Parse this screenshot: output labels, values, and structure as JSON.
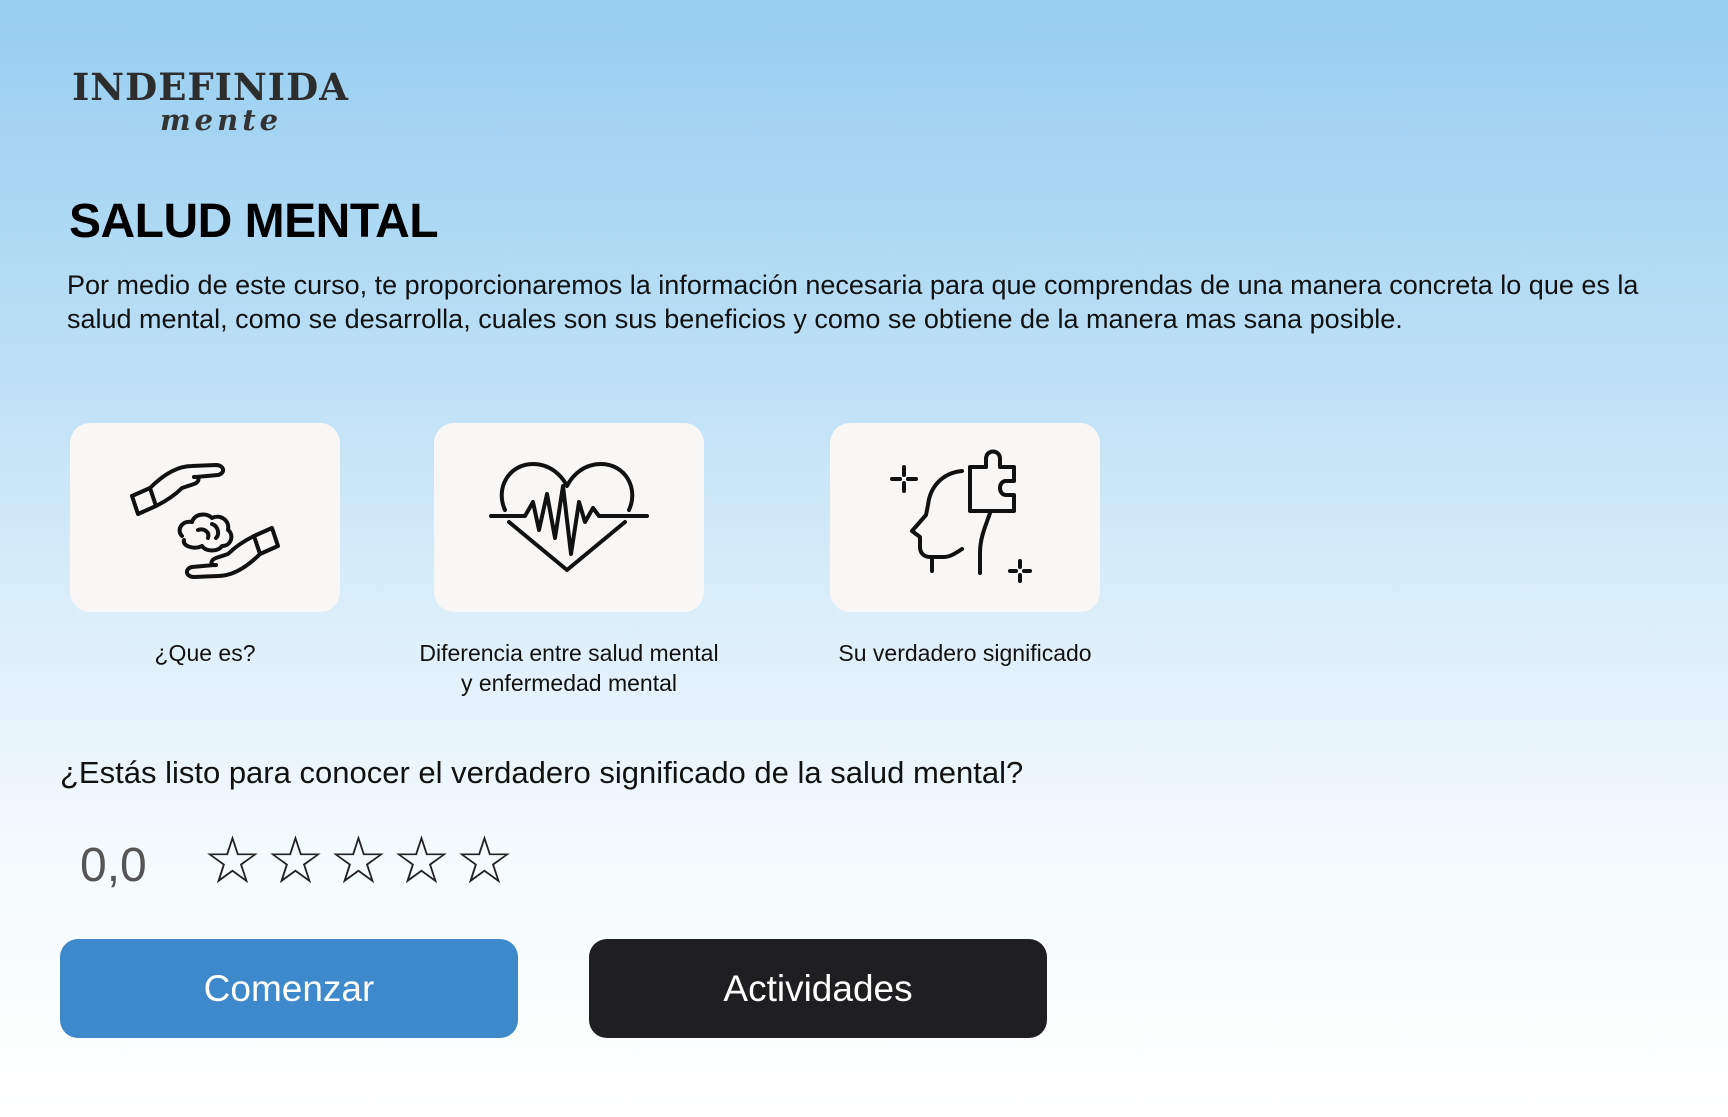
{
  "logo": {
    "main": "INDEFINIDA",
    "sub": "mente"
  },
  "page_title": "SALUD MENTAL",
  "intro": "Por medio de este curso, te proporcionaremos la información necesaria para que comprendas de una manera concreta lo que es la salud mental, como se desarrolla, cuales son sus beneficios y como se obtiene de la manera mas sana posible.",
  "cards": [
    {
      "label": "¿Que es?",
      "icon": "hands-brain-icon"
    },
    {
      "label": "Diferencia entre salud mental\ny enfermedad mental",
      "icon": "heart-pulse-icon"
    },
    {
      "label": "Su verdadero significado",
      "icon": "head-puzzle-icon"
    }
  ],
  "question": "¿Estás listo para conocer el verdadero significado de la salud mental?",
  "rating": {
    "value": "0,0",
    "max_stars": 5,
    "filled_stars": 0,
    "star_glyph": "☆"
  },
  "buttons": {
    "start_label": "Comenzar",
    "activities_label": "Actividades"
  },
  "colors": {
    "start_button": "#3d89cb",
    "activities_button": "#1f1e21",
    "card_background": "#f8f7f5",
    "background_top": "#97cef1",
    "background_bottom": "#ffffff"
  }
}
